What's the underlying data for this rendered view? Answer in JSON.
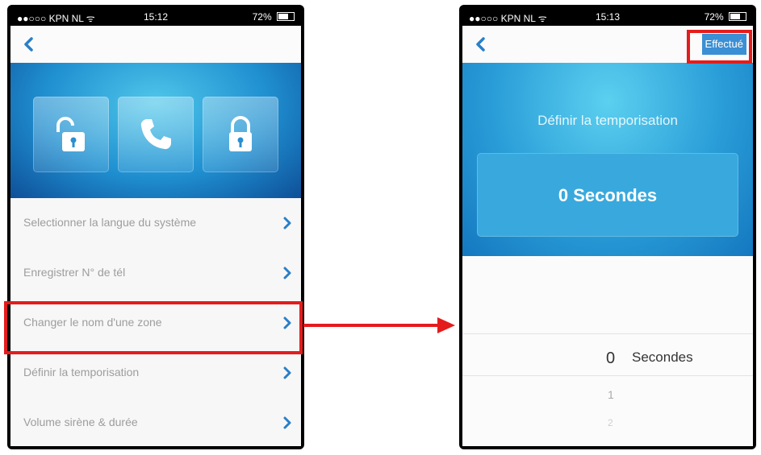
{
  "left_screen": {
    "status": {
      "carrier": "●●○○○ KPN NL ᯤ",
      "time": "15:12",
      "battery": "72%"
    },
    "menu_items": [
      {
        "label": "Selectionner la langue du système"
      },
      {
        "label": "Enregistrer N° de tél"
      },
      {
        "label": "Changer le nom d'une zone"
      },
      {
        "label": "Définir la temporisation"
      },
      {
        "label": "Volume sirène & durée"
      }
    ]
  },
  "right_screen": {
    "status": {
      "carrier": "●●○○○ KPN NL ᯤ",
      "time": "15:13",
      "battery": "72%"
    },
    "done_label": "Effectué",
    "title": "Définir la temporisation",
    "value": "0 Secondes",
    "picker": {
      "selected_number": "0",
      "unit": "Secondes",
      "next_options": [
        "1",
        "2"
      ]
    }
  },
  "colors": {
    "highlight": "#e41c1c",
    "accent_blue": "#1f8fd0",
    "chevron_blue": "#2a7fc7"
  }
}
